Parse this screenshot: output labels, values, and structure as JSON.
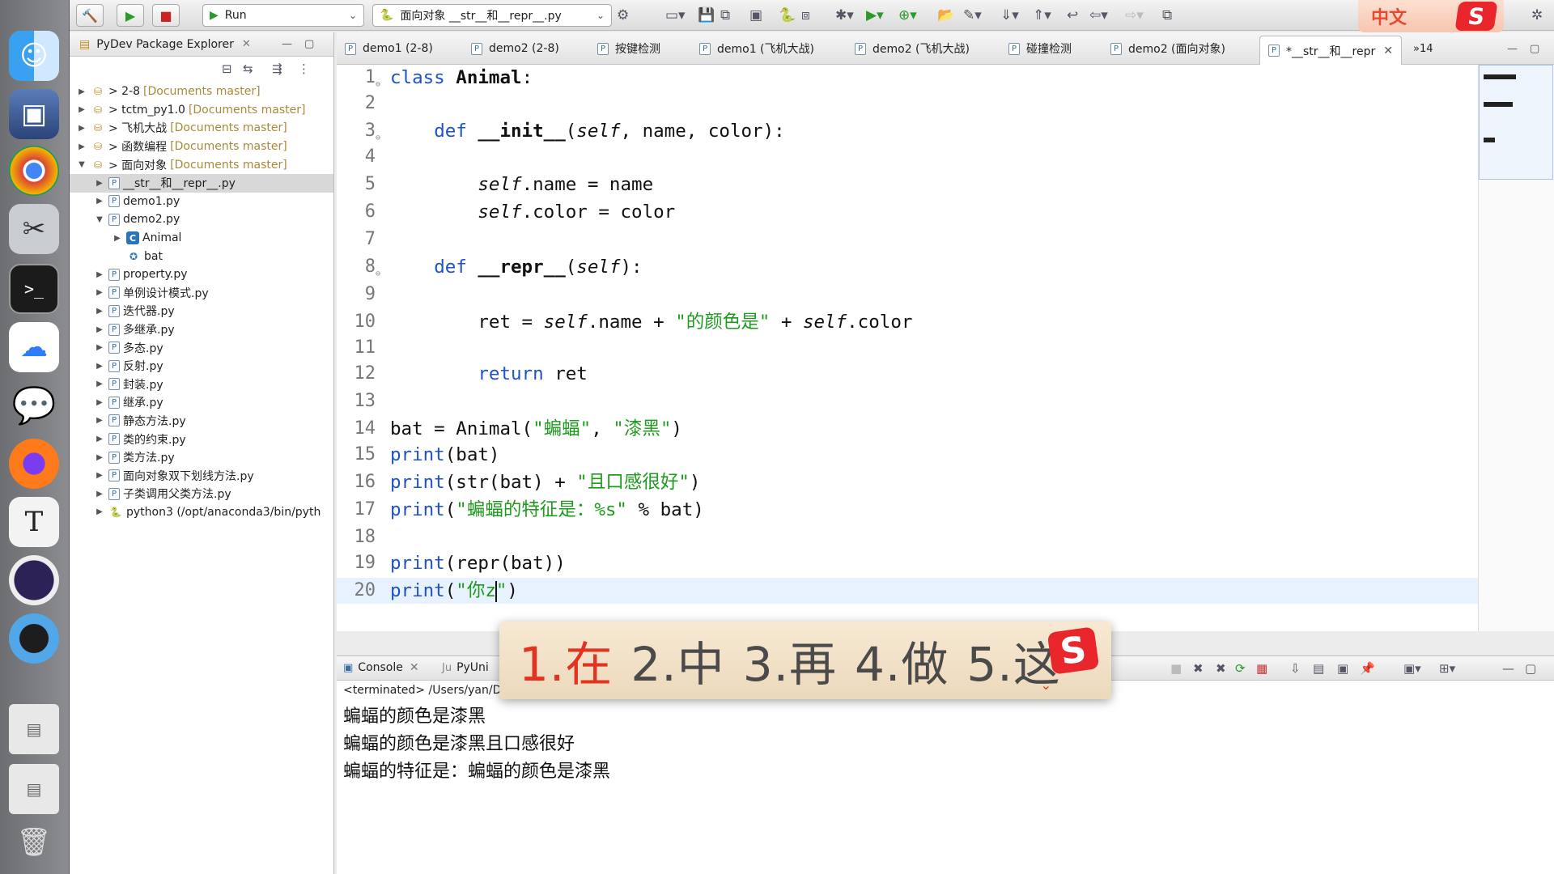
{
  "toolbar": {
    "run_config": "Run",
    "file_select": "面向对象 __str__和__repr__.py"
  },
  "ime_status": {
    "mode_label": "中文",
    "logo": "S"
  },
  "explorer": {
    "title": "PyDev Package Explorer",
    "items": [
      {
        "label": "> 2-8",
        "repo": "[Documents master]"
      },
      {
        "label": "> tctm_py1.0",
        "repo": "[Documents master]"
      },
      {
        "label": "> 飞机大战",
        "repo": "[Documents master]"
      },
      {
        "label": "> 函数编程",
        "repo": "[Documents master]"
      },
      {
        "label": "> 面向对象",
        "repo": "[Documents master]"
      },
      {
        "label": "__str__和__repr__.py"
      },
      {
        "label": "demo1.py"
      },
      {
        "label": "demo2.py"
      },
      {
        "label": "Animal"
      },
      {
        "label": "bat"
      },
      {
        "label": "property.py"
      },
      {
        "label": "单例设计模式.py"
      },
      {
        "label": "迭代器.py"
      },
      {
        "label": "多继承.py"
      },
      {
        "label": "多态.py"
      },
      {
        "label": "反射.py"
      },
      {
        "label": "封装.py"
      },
      {
        "label": "继承.py"
      },
      {
        "label": "静态方法.py"
      },
      {
        "label": "类的约束.py"
      },
      {
        "label": "类方法.py"
      },
      {
        "label": "面向对象双下划线方法.py"
      },
      {
        "label": "子类调用父类方法.py"
      },
      {
        "label": "python3  (/opt/anaconda3/bin/pyth"
      }
    ]
  },
  "editor_tabs": [
    {
      "label": "demo1 (2-8)"
    },
    {
      "label": "demo2 (2-8)"
    },
    {
      "label": "按键检测"
    },
    {
      "label": "demo1 (飞机大战)"
    },
    {
      "label": "demo2 (飞机大战)"
    },
    {
      "label": "碰撞检测"
    },
    {
      "label": "demo2 (面向对象)"
    },
    {
      "label": "*__str__和__repr"
    }
  ],
  "editor_overflow": "»14",
  "code": {
    "line_numbers": [
      "1",
      "2",
      "3",
      "4",
      "5",
      "6",
      "7",
      "8",
      "9",
      "10",
      "11",
      "12",
      "13",
      "14",
      "15",
      "16",
      "17",
      "18",
      "19",
      "20"
    ],
    "l1_kw": "class",
    "l1_name": " Animal",
    "l1_rest": ":",
    "l3_kw": "def",
    "l3_fn": " __init__",
    "l3_p1": "(",
    "l3_self": "self",
    "l3_rest": ", name, color):",
    "l5_self": "self",
    "l5_rest": ".name = name",
    "l6_self": "self",
    "l6_rest": ".color = color",
    "l8_kw": "def",
    "l8_fn": " __repr__",
    "l8_p1": "(",
    "l8_self": "self",
    "l8_rest": "):",
    "l10_a": "ret = ",
    "l10_self1": "self",
    "l10_b": ".name + ",
    "l10_str": "\"的颜色是\"",
    "l10_c": " + ",
    "l10_self2": "self",
    "l10_d": ".color",
    "l12_kw": "return",
    "l12_rest": " ret",
    "l14_a": "bat = Animal(",
    "l14_s1": "\"蝙蝠\"",
    "l14_b": ", ",
    "l14_s2": "\"漆黑\"",
    "l14_c": ")",
    "l15_bi": "print",
    "l15_rest": "(bat)",
    "l16_bi": "print",
    "l16_a": "(str(bat) + ",
    "l16_str": "\"且口感很好\"",
    "l16_b": ")",
    "l17_bi": "print",
    "l17_a": "(",
    "l17_str": "\"蝙蝠的特征是：%s\"",
    "l17_b": " % bat)",
    "l19_bi": "print",
    "l19_rest": "(repr(bat))",
    "l20_bi": "print",
    "l20_a": "(",
    "l20_str1": "\"你z",
    "l20_str2": "\"",
    "l20_b": ")"
  },
  "ime_candidates": {
    "c1": "1.在",
    "c2": "2.中",
    "c3": "3.再",
    "c4": "4.做",
    "c5": "5.这",
    "logo": "S",
    "more": "⌄"
  },
  "console": {
    "tab_console": "Console",
    "tab_pyunit": "PyUni",
    "status": "<terminated> /Users/yan/De",
    "output": [
      "蝙蝠的颜色是漆黑",
      "蝙蝠的颜色是漆黑且口感很好",
      "蝙蝠的特征是：蝙蝠的颜色是漆黑"
    ]
  }
}
